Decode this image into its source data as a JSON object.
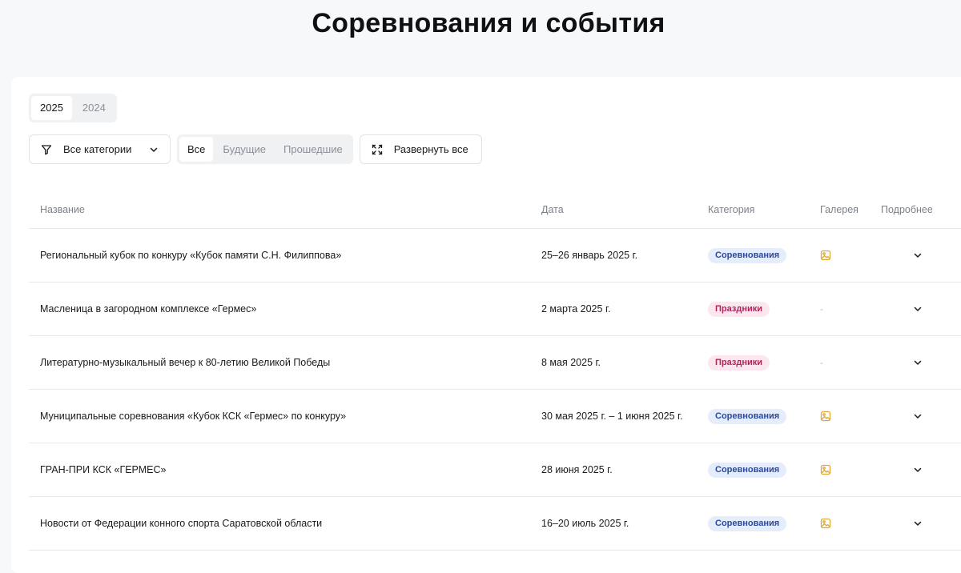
{
  "page": {
    "title": "Соревнования и события"
  },
  "years": {
    "tabs": [
      "2025",
      "2024"
    ],
    "active": "2025"
  },
  "filters": {
    "category_label": "Все категории",
    "time_filter": [
      "Все",
      "Будущие",
      "Прошедшие"
    ],
    "expand_label": "Развернуть все"
  },
  "table": {
    "headers": {
      "name": "Название",
      "date": "Дата",
      "category": "Категория",
      "gallery": "Галерея",
      "more": "Подробнее"
    },
    "rows": [
      {
        "name": "Региональный кубок по конкуру «Кубок памяти С.Н. Филиппова»",
        "date": "25–26 январь 2025 г.",
        "category": "Соревнования",
        "category_type": "comp",
        "gallery": "image-icon"
      },
      {
        "name": "Масленица в загородном комплексе «Гермес»",
        "date": "2 марта 2025 г.",
        "category": "Праздники",
        "category_type": "holiday",
        "gallery": "-"
      },
      {
        "name": "Литературно-музыкальный вечер к 80-летию Великой Победы",
        "date": "8 мая 2025 г.",
        "category": "Праздники",
        "category_type": "holiday",
        "gallery": "-"
      },
      {
        "name": "Муниципальные соревнования «Кубок КСК «Гермес» по конкуру»",
        "date": "30 мая 2025 г. – 1 июня 2025 г.",
        "category": "Соревнования",
        "category_type": "comp",
        "gallery": "image-icon"
      },
      {
        "name": "ГРАН-ПРИ КСК «ГЕРМЕС»",
        "date": "28 июня 2025 г.",
        "category": "Соревнования",
        "category_type": "comp",
        "gallery": "image-icon"
      },
      {
        "name": "Новости от Федерации конного спорта Саратовской области",
        "date": "16–20 июль 2025 г.",
        "category": "Соревнования",
        "category_type": "comp",
        "gallery": "image-icon"
      }
    ]
  },
  "colors": {
    "comp_bg": "#e5ecfb",
    "comp_text": "#2b4a9c",
    "holiday_bg": "#fde7ef",
    "holiday_text": "#b0245a",
    "gallery_icon": "#e0a83a"
  }
}
